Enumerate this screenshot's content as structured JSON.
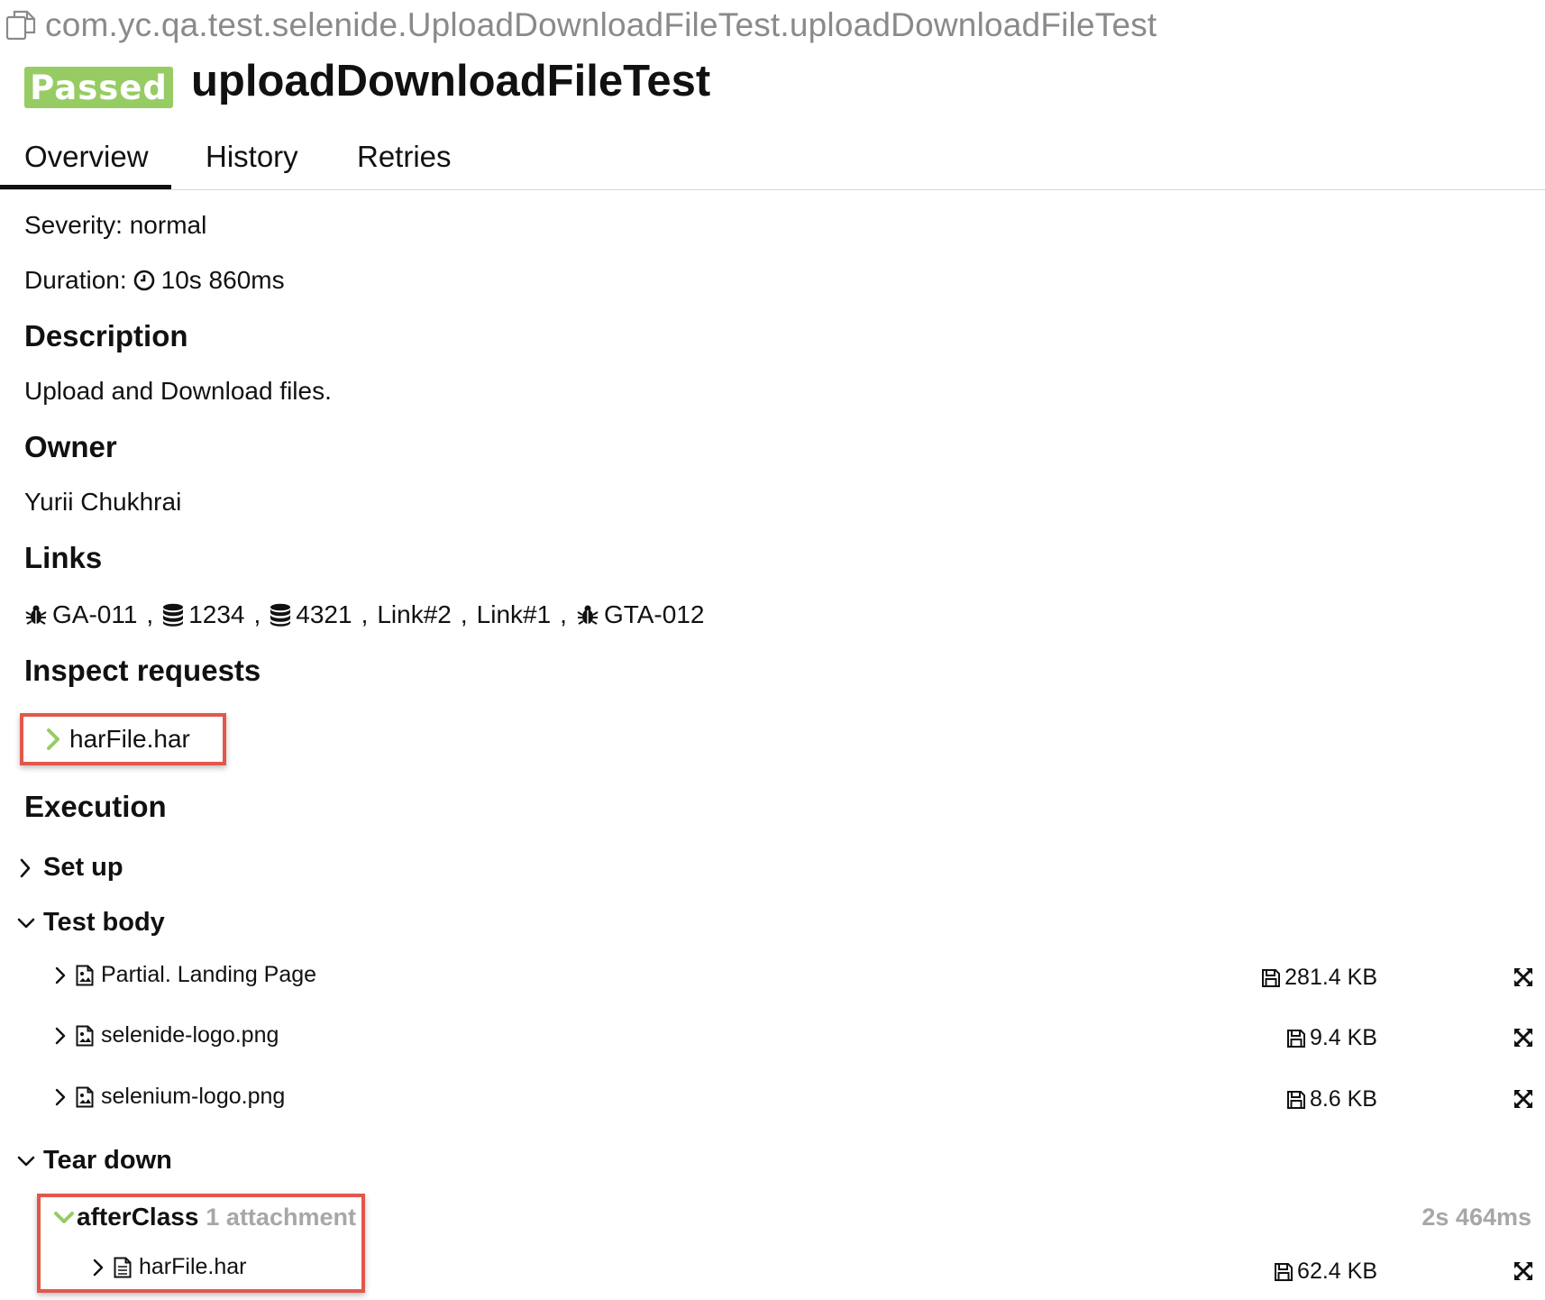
{
  "header": {
    "full_name": "com.yc.qa.test.selenide.UploadDownloadFileTest.uploadDownloadFileTest",
    "status": "Passed",
    "title": "uploadDownloadFileTest",
    "status_color": "#97cc64"
  },
  "tabs": [
    {
      "label": "Overview",
      "active": true
    },
    {
      "label": "History",
      "active": false
    },
    {
      "label": "Retries",
      "active": false
    }
  ],
  "overview": {
    "severity_label": "Severity:",
    "severity_value": "normal",
    "duration_label": "Duration:",
    "duration_value": "10s 860ms",
    "description_heading": "Description",
    "description_text": "Upload and Download files.",
    "owner_heading": "Owner",
    "owner_name": "Yurii Chukhrai",
    "links_heading": "Links",
    "links": [
      {
        "icon": "bug-icon",
        "label": "GA-011"
      },
      {
        "icon": "database-icon",
        "label": "1234"
      },
      {
        "icon": "database-icon",
        "label": "4321"
      },
      {
        "icon": "",
        "label": "Link#2"
      },
      {
        "icon": "",
        "label": "Link#1"
      },
      {
        "icon": "bug-icon",
        "label": "GTA-012"
      }
    ],
    "links_separator": ",",
    "inspect_heading": "Inspect requests",
    "har_file": "harFile.har",
    "highlight_color": "#e2574c"
  },
  "execution": {
    "heading": "Execution",
    "setup_label": "Set up",
    "test_body_label": "Test body",
    "attachments": [
      {
        "name": "Partial. Landing Page",
        "size": "281.4 KB",
        "icon": "image-file-icon"
      },
      {
        "name": "selenide-logo.png",
        "size": "9.4 KB",
        "icon": "image-file-icon"
      },
      {
        "name": "selenium-logo.png",
        "size": "8.6 KB",
        "icon": "image-file-icon"
      }
    ],
    "teardown_label": "Tear down",
    "after_class": {
      "name": "afterClass",
      "meta": "1 attachment",
      "duration": "2s 464ms",
      "attachment_name": "harFile.har",
      "attachment_size": "62.4 KB",
      "attachment_icon": "text-file-icon"
    }
  }
}
